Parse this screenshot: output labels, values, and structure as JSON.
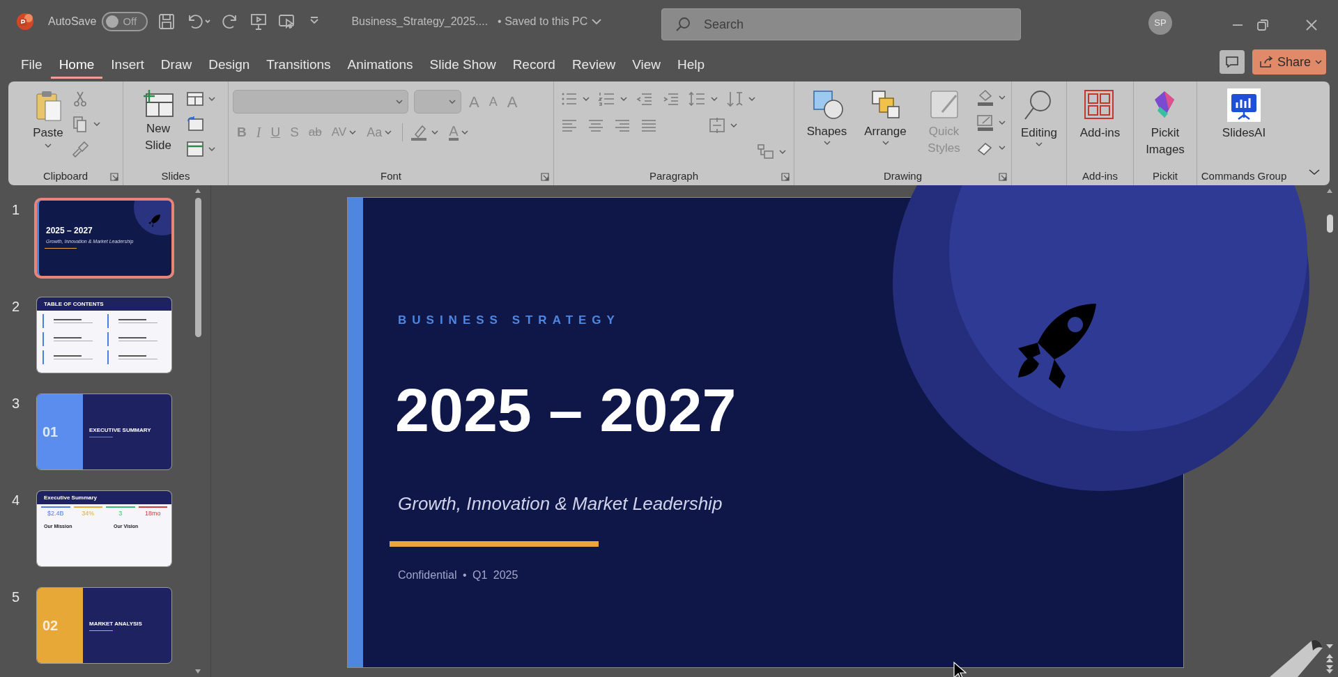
{
  "title_bar": {
    "autosave_label": "AutoSave",
    "autosave": {
      "on": false,
      "text": "Off"
    },
    "file_name": "Business_Strategy_2025....",
    "save_status": "• Saved to this PC",
    "search_placeholder": "Search",
    "avatar": "SP"
  },
  "menu_tabs": [
    {
      "label": "File",
      "selected": false
    },
    {
      "label": "Home",
      "selected": true
    },
    {
      "label": "Insert",
      "selected": false
    },
    {
      "label": "Draw",
      "selected": false
    },
    {
      "label": "Design",
      "selected": false
    },
    {
      "label": "Transitions",
      "selected": false
    },
    {
      "label": "Animations",
      "selected": false
    },
    {
      "label": "Slide Show",
      "selected": false
    },
    {
      "label": "Record",
      "selected": false
    },
    {
      "label": "Review",
      "selected": false
    },
    {
      "label": "View",
      "selected": false
    },
    {
      "label": "Help",
      "selected": false
    }
  ],
  "share_label": "Share",
  "ribbon": [
    {
      "kind": "clipboard",
      "label": "Clipboard",
      "button": "Paste"
    },
    {
      "kind": "slides",
      "label": "Slides",
      "button": "New Slide"
    },
    {
      "kind": "font",
      "label": "Font",
      "row1": [
        {
          "kind": "grow",
          "text": "A"
        },
        {
          "kind": "shrink",
          "text": "A"
        },
        {
          "kind": "clear",
          "text": "A"
        }
      ],
      "row2": [
        {
          "kind": "bold",
          "text": "B"
        },
        {
          "kind": "italic",
          "text": "I"
        },
        {
          "kind": "underline",
          "text": "U"
        },
        {
          "kind": "shadow",
          "text": "S"
        },
        {
          "kind": "strike",
          "text": "ab"
        },
        {
          "kind": "spacing",
          "text": "AV"
        },
        {
          "kind": "case",
          "text": "Aa"
        },
        {
          "kind": "highlight"
        },
        {
          "kind": "color",
          "text": "A"
        }
      ]
    },
    {
      "kind": "paragraph",
      "label": "Paragraph"
    },
    {
      "kind": "drawing",
      "label": "Drawing",
      "buttons": [
        {
          "label": "Shapes",
          "disabled": false
        },
        {
          "label": "Arrange",
          "disabled": false
        },
        {
          "label": "Quick Styles",
          "disabled": true
        }
      ]
    },
    {
      "kind": "editing",
      "button": "Editing"
    },
    {
      "kind": "addins",
      "label": "Add-ins",
      "button": "Add-ins"
    },
    {
      "kind": "pickit",
      "label": "Pickit",
      "button": "Pickit Images"
    },
    {
      "kind": "slidesai",
      "label": "Commands Group",
      "button": "SlidesAI"
    }
  ],
  "thumbnails": [
    {
      "number": "1",
      "selected": true,
      "kind": "title",
      "title": "2025 – 2027",
      "subtitle": "Growth, Innovation & Market Leadership"
    },
    {
      "number": "2",
      "selected": false,
      "kind": "toc",
      "title": "TABLE OF CONTENTS"
    },
    {
      "number": "3",
      "selected": false,
      "kind": "section",
      "color": "#5b8def",
      "section": "01",
      "title": "EXECUTIVE SUMMARY"
    },
    {
      "number": "4",
      "selected": false,
      "kind": "summary",
      "title": "Executive Summary",
      "stats": [
        {
          "value": "$2.4B",
          "color": "#4a7ee0"
        },
        {
          "value": "34%",
          "color": "#e8a838"
        },
        {
          "value": "3",
          "color": "#2fbf71"
        },
        {
          "value": "18mo",
          "color": "#d03a3a"
        }
      ],
      "headings": [
        "Our Mission",
        "Our Vision"
      ]
    },
    {
      "number": "5",
      "selected": false,
      "kind": "section",
      "color": "#e8a838",
      "section": "02",
      "title": "MARKET ANALYSIS"
    }
  ],
  "slide": {
    "eyebrow": "BUSINESS STRATEGY",
    "title": "2025 – 2027",
    "subtitle": "Growth, Innovation & Market Leadership",
    "footer": "Confidential • Q1 2025"
  }
}
